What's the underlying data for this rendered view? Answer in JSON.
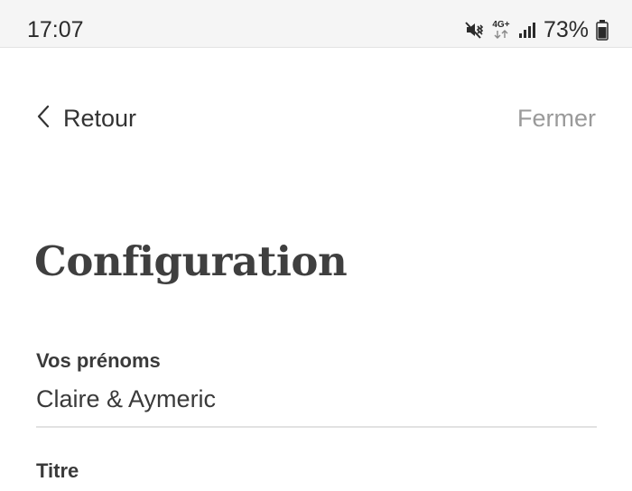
{
  "status_bar": {
    "time": "17:07",
    "network": "4G+",
    "battery": "73%",
    "icons": [
      "mute-vibrate-icon",
      "network-data-icon",
      "signal-icon",
      "battery-icon"
    ]
  },
  "nav": {
    "back_label": "Retour",
    "close_label": "Fermer",
    "icons": [
      "chevron-left-icon"
    ]
  },
  "page": {
    "title": "Configuration"
  },
  "form": {
    "first_names": {
      "label": "Vos prénoms",
      "value": "Claire & Aymeric"
    },
    "title_field": {
      "label": "Titre"
    }
  },
  "colors": {
    "text": "#333333",
    "muted": "#9a9a9a",
    "divider": "#e2e2e2",
    "status_bg": "#f5f5f5"
  }
}
